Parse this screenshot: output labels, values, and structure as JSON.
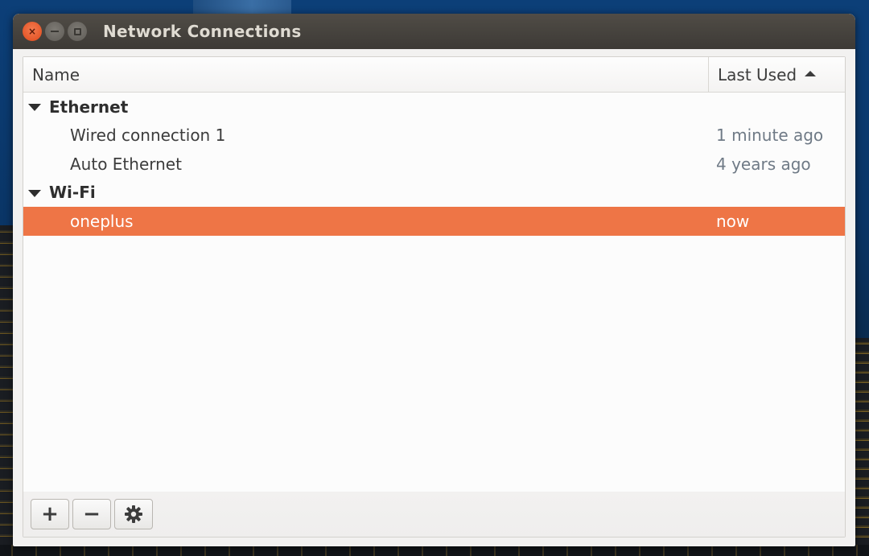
{
  "window": {
    "title": "Network Connections",
    "controls": {
      "close_glyph": "×"
    }
  },
  "columns": {
    "name": "Name",
    "last_used": "Last Used",
    "sort": "ascending"
  },
  "groups": [
    {
      "label": "Ethernet",
      "expanded": true,
      "connections": [
        {
          "name": "Wired connection 1",
          "last_used": "1 minute ago",
          "selected": false
        },
        {
          "name": "Auto Ethernet",
          "last_used": "4 years ago",
          "selected": false
        }
      ]
    },
    {
      "label": "Wi-Fi",
      "expanded": true,
      "connections": [
        {
          "name": "oneplus",
          "last_used": "now",
          "selected": true
        }
      ]
    }
  ],
  "toolbar": {
    "add_glyph": "+",
    "remove_glyph": "−",
    "settings_icon": "gear-icon"
  },
  "colors": {
    "selection": "#ee7546",
    "titlebar": "#3d3a36",
    "close_button": "#df4a1c",
    "time_text": "#6f7a86"
  }
}
